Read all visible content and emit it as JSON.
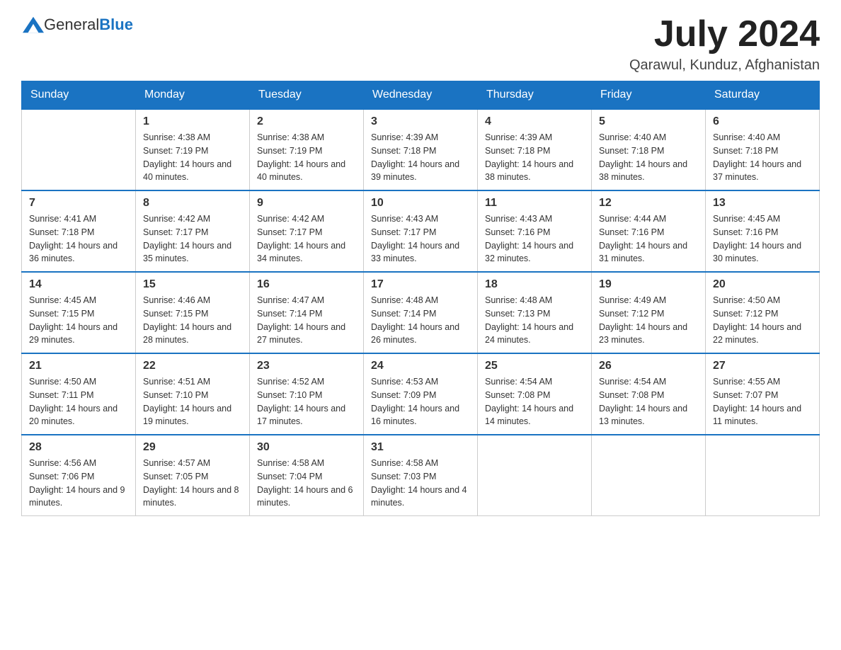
{
  "header": {
    "logo_text_normal": "General",
    "logo_text_blue": "Blue",
    "month_year": "July 2024",
    "location": "Qarawul, Kunduz, Afghanistan"
  },
  "days_of_week": [
    "Sunday",
    "Monday",
    "Tuesday",
    "Wednesday",
    "Thursday",
    "Friday",
    "Saturday"
  ],
  "weeks": [
    [
      {
        "num": "",
        "sunrise": "",
        "sunset": "",
        "daylight": ""
      },
      {
        "num": "1",
        "sunrise": "Sunrise: 4:38 AM",
        "sunset": "Sunset: 7:19 PM",
        "daylight": "Daylight: 14 hours and 40 minutes."
      },
      {
        "num": "2",
        "sunrise": "Sunrise: 4:38 AM",
        "sunset": "Sunset: 7:19 PM",
        "daylight": "Daylight: 14 hours and 40 minutes."
      },
      {
        "num": "3",
        "sunrise": "Sunrise: 4:39 AM",
        "sunset": "Sunset: 7:18 PM",
        "daylight": "Daylight: 14 hours and 39 minutes."
      },
      {
        "num": "4",
        "sunrise": "Sunrise: 4:39 AM",
        "sunset": "Sunset: 7:18 PM",
        "daylight": "Daylight: 14 hours and 38 minutes."
      },
      {
        "num": "5",
        "sunrise": "Sunrise: 4:40 AM",
        "sunset": "Sunset: 7:18 PM",
        "daylight": "Daylight: 14 hours and 38 minutes."
      },
      {
        "num": "6",
        "sunrise": "Sunrise: 4:40 AM",
        "sunset": "Sunset: 7:18 PM",
        "daylight": "Daylight: 14 hours and 37 minutes."
      }
    ],
    [
      {
        "num": "7",
        "sunrise": "Sunrise: 4:41 AM",
        "sunset": "Sunset: 7:18 PM",
        "daylight": "Daylight: 14 hours and 36 minutes."
      },
      {
        "num": "8",
        "sunrise": "Sunrise: 4:42 AM",
        "sunset": "Sunset: 7:17 PM",
        "daylight": "Daylight: 14 hours and 35 minutes."
      },
      {
        "num": "9",
        "sunrise": "Sunrise: 4:42 AM",
        "sunset": "Sunset: 7:17 PM",
        "daylight": "Daylight: 14 hours and 34 minutes."
      },
      {
        "num": "10",
        "sunrise": "Sunrise: 4:43 AM",
        "sunset": "Sunset: 7:17 PM",
        "daylight": "Daylight: 14 hours and 33 minutes."
      },
      {
        "num": "11",
        "sunrise": "Sunrise: 4:43 AM",
        "sunset": "Sunset: 7:16 PM",
        "daylight": "Daylight: 14 hours and 32 minutes."
      },
      {
        "num": "12",
        "sunrise": "Sunrise: 4:44 AM",
        "sunset": "Sunset: 7:16 PM",
        "daylight": "Daylight: 14 hours and 31 minutes."
      },
      {
        "num": "13",
        "sunrise": "Sunrise: 4:45 AM",
        "sunset": "Sunset: 7:16 PM",
        "daylight": "Daylight: 14 hours and 30 minutes."
      }
    ],
    [
      {
        "num": "14",
        "sunrise": "Sunrise: 4:45 AM",
        "sunset": "Sunset: 7:15 PM",
        "daylight": "Daylight: 14 hours and 29 minutes."
      },
      {
        "num": "15",
        "sunrise": "Sunrise: 4:46 AM",
        "sunset": "Sunset: 7:15 PM",
        "daylight": "Daylight: 14 hours and 28 minutes."
      },
      {
        "num": "16",
        "sunrise": "Sunrise: 4:47 AM",
        "sunset": "Sunset: 7:14 PM",
        "daylight": "Daylight: 14 hours and 27 minutes."
      },
      {
        "num": "17",
        "sunrise": "Sunrise: 4:48 AM",
        "sunset": "Sunset: 7:14 PM",
        "daylight": "Daylight: 14 hours and 26 minutes."
      },
      {
        "num": "18",
        "sunrise": "Sunrise: 4:48 AM",
        "sunset": "Sunset: 7:13 PM",
        "daylight": "Daylight: 14 hours and 24 minutes."
      },
      {
        "num": "19",
        "sunrise": "Sunrise: 4:49 AM",
        "sunset": "Sunset: 7:12 PM",
        "daylight": "Daylight: 14 hours and 23 minutes."
      },
      {
        "num": "20",
        "sunrise": "Sunrise: 4:50 AM",
        "sunset": "Sunset: 7:12 PM",
        "daylight": "Daylight: 14 hours and 22 minutes."
      }
    ],
    [
      {
        "num": "21",
        "sunrise": "Sunrise: 4:50 AM",
        "sunset": "Sunset: 7:11 PM",
        "daylight": "Daylight: 14 hours and 20 minutes."
      },
      {
        "num": "22",
        "sunrise": "Sunrise: 4:51 AM",
        "sunset": "Sunset: 7:10 PM",
        "daylight": "Daylight: 14 hours and 19 minutes."
      },
      {
        "num": "23",
        "sunrise": "Sunrise: 4:52 AM",
        "sunset": "Sunset: 7:10 PM",
        "daylight": "Daylight: 14 hours and 17 minutes."
      },
      {
        "num": "24",
        "sunrise": "Sunrise: 4:53 AM",
        "sunset": "Sunset: 7:09 PM",
        "daylight": "Daylight: 14 hours and 16 minutes."
      },
      {
        "num": "25",
        "sunrise": "Sunrise: 4:54 AM",
        "sunset": "Sunset: 7:08 PM",
        "daylight": "Daylight: 14 hours and 14 minutes."
      },
      {
        "num": "26",
        "sunrise": "Sunrise: 4:54 AM",
        "sunset": "Sunset: 7:08 PM",
        "daylight": "Daylight: 14 hours and 13 minutes."
      },
      {
        "num": "27",
        "sunrise": "Sunrise: 4:55 AM",
        "sunset": "Sunset: 7:07 PM",
        "daylight": "Daylight: 14 hours and 11 minutes."
      }
    ],
    [
      {
        "num": "28",
        "sunrise": "Sunrise: 4:56 AM",
        "sunset": "Sunset: 7:06 PM",
        "daylight": "Daylight: 14 hours and 9 minutes."
      },
      {
        "num": "29",
        "sunrise": "Sunrise: 4:57 AM",
        "sunset": "Sunset: 7:05 PM",
        "daylight": "Daylight: 14 hours and 8 minutes."
      },
      {
        "num": "30",
        "sunrise": "Sunrise: 4:58 AM",
        "sunset": "Sunset: 7:04 PM",
        "daylight": "Daylight: 14 hours and 6 minutes."
      },
      {
        "num": "31",
        "sunrise": "Sunrise: 4:58 AM",
        "sunset": "Sunset: 7:03 PM",
        "daylight": "Daylight: 14 hours and 4 minutes."
      },
      {
        "num": "",
        "sunrise": "",
        "sunset": "",
        "daylight": ""
      },
      {
        "num": "",
        "sunrise": "",
        "sunset": "",
        "daylight": ""
      },
      {
        "num": "",
        "sunrise": "",
        "sunset": "",
        "daylight": ""
      }
    ]
  ]
}
